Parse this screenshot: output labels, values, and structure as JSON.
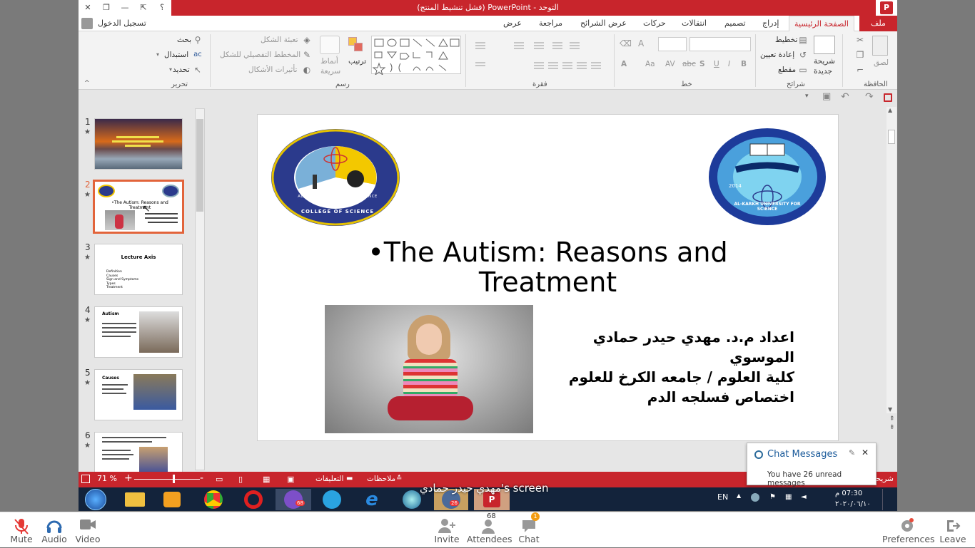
{
  "window": {
    "title": "التوحد - PowerPoint (فشل تنشيط المنتج)",
    "help": "؟",
    "signin": "تسجيل الدخول"
  },
  "ribbon_tabs": [
    "ملف",
    "الصفحة الرئيسية",
    "إدراج",
    "تصميم",
    "انتقالات",
    "حركات",
    "عرض الشرائح",
    "مراجعة",
    "عرض"
  ],
  "ribbon": {
    "groups": {
      "clipboard": "الحافظة",
      "slides": "شرائح",
      "font": "خط",
      "paragraph": "فقرة",
      "drawing": "رسم",
      "editing": "تحرير"
    },
    "paste": "لصق",
    "new_slide_1": "شريحة",
    "new_slide_2": "جديدة",
    "layout": "تخطيط",
    "reset": "إعادة تعيين",
    "section": "مقطع",
    "arrange": "ترتيب",
    "quick_styles_1": "أنماط",
    "quick_styles_2": "سريعة",
    "shape_fill": "تعبئة الشكل",
    "shape_outline": "المخطط التفصيلي للشكل",
    "shape_effects": "تأثيرات الأشكال",
    "find": "بحث",
    "replace": "استبدال",
    "select": "تحديد",
    "font_b": "B",
    "font_i": "I",
    "font_u": "U",
    "font_s": "S",
    "font_abc": "abc",
    "font_av": "AV",
    "font_aa": "Aa",
    "font_a": "A"
  },
  "thumbnails": [
    {
      "num": "1",
      "star": "★"
    },
    {
      "num": "2",
      "star": "★",
      "title": "•The Autism: Reasons and Treatment"
    },
    {
      "num": "3",
      "star": "★",
      "title": "Lecture Axis",
      "items": [
        "Definition",
        "Causes",
        "Sign and Symptoms",
        "Types",
        "Treatment"
      ]
    },
    {
      "num": "4",
      "star": "★",
      "title": "Autism"
    },
    {
      "num": "5",
      "star": "★",
      "title": "Causes"
    },
    {
      "num": "6",
      "star": "★"
    }
  ],
  "slide": {
    "title_line1": "•The Autism: Reasons and",
    "title_line2": "Treatment",
    "author_lines": [
      "اعداد م.د. مهدي حيدر حمادي الموسوي",
      "كلية العلوم / جامعه الكرخ للعلوم",
      "اختصاص فسلجه الدم"
    ],
    "logo_left": "COLLEGE OF SCIENCE",
    "logo_left_sub": "AL-KARKH UNIVERSITY OF SCIENCE",
    "logo_right": "AL-KARKH UNIVERSITY FOR SCIENCE",
    "logo_right_year": "2014"
  },
  "status": {
    "zoom": "71 %",
    "comments": "التعليقات",
    "notes": "ملاحظات",
    "slide_label": "شريحة"
  },
  "taskbar": {
    "viber_badge": "68",
    "zoom_badge": "26",
    "lang": "EN",
    "time": "07:30 م",
    "date": "٢٠٢٠/٠٦/١٠",
    "screen_label": "مهدي حيدر حمادي's screen"
  },
  "chat": {
    "title": "Chat Messages",
    "body": "You have 26 unread messages"
  },
  "meeting_bar": {
    "mute": "Mute",
    "audio": "Audio",
    "video": "Video",
    "invite": "Invite",
    "attendees": "Attendees",
    "attendees_count": "68",
    "chat": "Chat",
    "chat_badge": "1",
    "preferences": "Preferences",
    "leave": "Leave"
  },
  "colors": {
    "ppt_red": "#c8252c",
    "accent_orange": "#e2643b",
    "taskbar": "#13233b",
    "zoom_blue": "#2d8cff"
  }
}
